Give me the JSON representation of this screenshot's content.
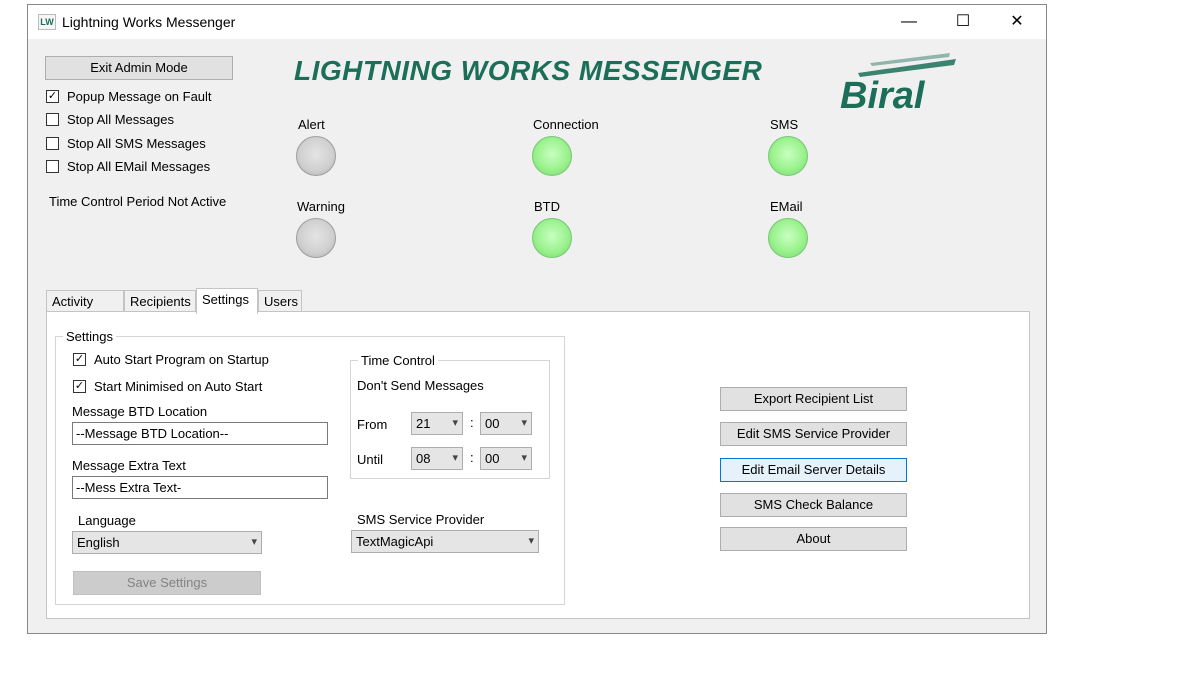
{
  "window": {
    "app_icon_text": "LW",
    "title": "Lightning Works Messenger",
    "controls": {
      "minimize": "—",
      "maximize": "☐",
      "close": "✕"
    }
  },
  "header": {
    "exit_admin_button": "Exit Admin Mode",
    "banner_title": "LIGHTNING WORKS MESSENGER",
    "logo_text": "Biral",
    "checkboxes": [
      {
        "label": "Popup Message on Fault",
        "checked": true
      },
      {
        "label": "Stop All Messages",
        "checked": false
      },
      {
        "label": "Stop All SMS Messages",
        "checked": false
      },
      {
        "label": "Stop All EMail Messages",
        "checked": false
      }
    ],
    "time_control_status": "Time Control Period Not Active"
  },
  "indicators": [
    {
      "label": "Alert",
      "state": "off",
      "color": "#cfcfcf"
    },
    {
      "label": "Connection",
      "state": "on",
      "color": "#9bf28e"
    },
    {
      "label": "SMS",
      "state": "on",
      "color": "#9bf28e"
    },
    {
      "label": "Warning",
      "state": "off",
      "color": "#cfcfcf"
    },
    {
      "label": "BTD",
      "state": "on",
      "color": "#9bf28e"
    },
    {
      "label": "EMail",
      "state": "on",
      "color": "#9bf28e"
    }
  ],
  "tabs": [
    {
      "label": "Activity Log",
      "active": false
    },
    {
      "label": "Recipients",
      "active": false
    },
    {
      "label": "Settings",
      "active": true
    },
    {
      "label": "Users",
      "active": false
    }
  ],
  "settings": {
    "group_title": "Settings",
    "auto_start": {
      "label": "Auto Start Program on Startup",
      "checked": true
    },
    "start_minimised": {
      "label": "Start Minimised on Auto Start",
      "checked": true
    },
    "btd_location_label": "Message BTD Location",
    "btd_location_value": "--Message BTD Location--",
    "extra_text_label": "Message Extra Text",
    "extra_text_value": "--Mess Extra Text-",
    "language_label": "Language",
    "language_value": "English",
    "save_button": "Save Settings",
    "time_control": {
      "group_title": "Time Control",
      "subtitle": "Don't Send Messages",
      "from_label": "From",
      "from_hour": "21",
      "from_minute": "00",
      "until_label": "Until",
      "until_hour": "08",
      "until_minute": "00",
      "separator": ":"
    },
    "sms_provider_label": "SMS Service Provider",
    "sms_provider_value": "TextMagicApi"
  },
  "actions": [
    {
      "label": "Export Recipient List"
    },
    {
      "label": "Edit SMS Service Provider"
    },
    {
      "label": "Edit Email Server Details"
    },
    {
      "label": "SMS Check Balance"
    },
    {
      "label": "About"
    }
  ],
  "colors": {
    "banner": "#1b6e58",
    "logo": "#1b6e58",
    "led_on": "#9bf28e",
    "led_off": "#cfcfcf",
    "focus_border": "#0078d7"
  },
  "icons": {
    "dropdown": "▾",
    "check": "✓"
  }
}
